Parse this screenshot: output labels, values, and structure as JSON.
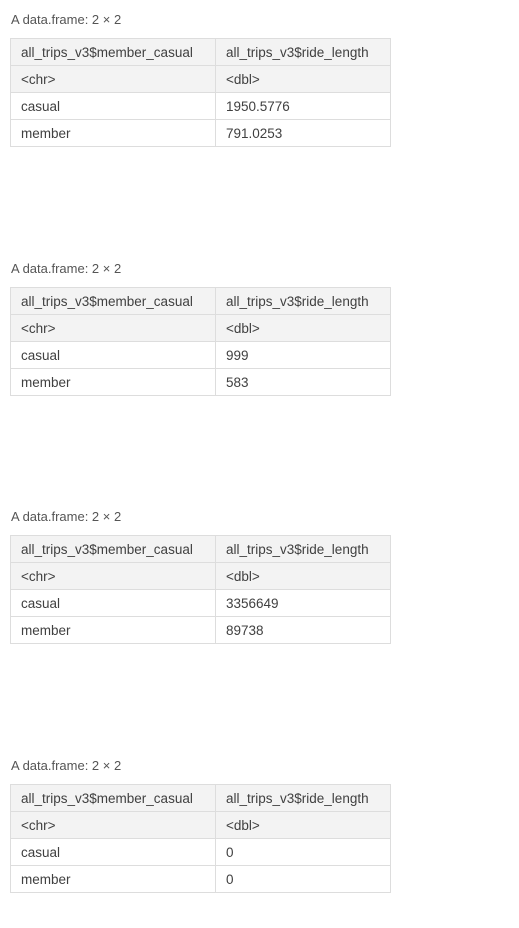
{
  "tables": [
    {
      "caption": "A data.frame: 2 × 2",
      "columns": [
        "all_trips_v3$member_casual",
        "all_trips_v3$ride_length"
      ],
      "types": [
        "<chr>",
        "<dbl>"
      ],
      "rows": [
        [
          "casual",
          "1950.5776"
        ],
        [
          "member",
          "791.0253"
        ]
      ]
    },
    {
      "caption": "A data.frame: 2 × 2",
      "columns": [
        "all_trips_v3$member_casual",
        "all_trips_v3$ride_length"
      ],
      "types": [
        "<chr>",
        "<dbl>"
      ],
      "rows": [
        [
          "casual",
          "999"
        ],
        [
          "member",
          "583"
        ]
      ]
    },
    {
      "caption": "A data.frame: 2 × 2",
      "columns": [
        "all_trips_v3$member_casual",
        "all_trips_v3$ride_length"
      ],
      "types": [
        "<chr>",
        "<dbl>"
      ],
      "rows": [
        [
          "casual",
          "3356649"
        ],
        [
          "member",
          "89738"
        ]
      ]
    },
    {
      "caption": "A data.frame: 2 × 2",
      "columns": [
        "all_trips_v3$member_casual",
        "all_trips_v3$ride_length"
      ],
      "types": [
        "<chr>",
        "<dbl>"
      ],
      "rows": [
        [
          "casual",
          "0"
        ],
        [
          "member",
          "0"
        ]
      ]
    }
  ]
}
